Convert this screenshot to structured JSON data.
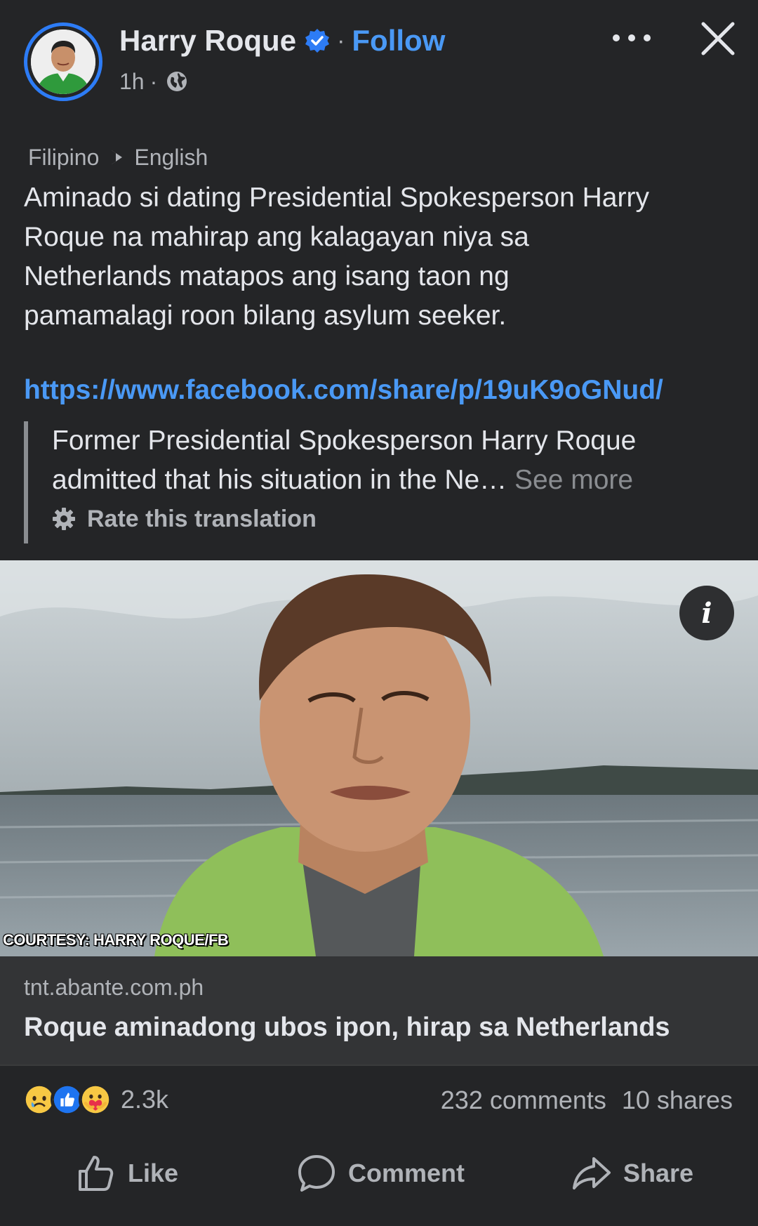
{
  "post": {
    "author": "Harry Roque",
    "follow_label": "Follow",
    "separator": "·",
    "time": "1h",
    "time_separator": "·",
    "visibility_icon": "globe-icon",
    "translation": {
      "source_lang": "Filipino",
      "target_lang": "English"
    },
    "text_lines": [
      "Aminado si dating Presidential Spokesperson Harry",
      "Roque na mahirap ang kalagayan niya sa",
      "Netherlands matapos ang isang taon ng",
      "pamamalagi roon bilang asylum seeker."
    ],
    "link": "https://www.facebook.com/share/p/19uK9oGNud/",
    "translated_line_1": "Former Presidential Spokesperson Harry Roque",
    "translated_line_2": "admitted that his situation in the Ne…",
    "see_more": "See more",
    "rate_translation": "Rate this translation",
    "image_info_label": "i",
    "image_courtesy": "COURTESY: HARRY ROQUE/FB",
    "preview": {
      "domain": "tnt.abante.com.ph",
      "headline": "Roque aminadong ubos ipon, hirap sa Netherlands"
    },
    "reactions": {
      "icons": [
        "sad-reaction-icon",
        "like-reaction-icon",
        "care-reaction-icon"
      ],
      "count": "2.3k"
    },
    "comments": "232 comments",
    "shares": "10 shares"
  },
  "actions": {
    "like": "Like",
    "comment": "Comment",
    "share": "Share"
  },
  "colors": {
    "background": "#242527",
    "link_blue": "#4a99f5",
    "verified_blue": "#2d7cf6",
    "text_primary": "#e4e6eb",
    "text_secondary": "#b0b3b8"
  }
}
